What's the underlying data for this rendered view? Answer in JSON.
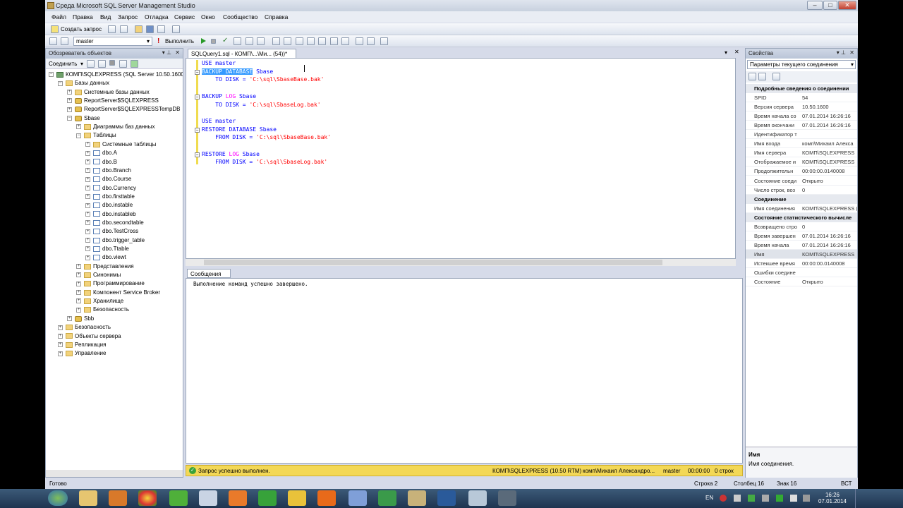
{
  "window": {
    "title": "Среда Microsoft SQL Server Management Studio"
  },
  "menu": [
    "Файл",
    "Правка",
    "Вид",
    "Запрос",
    "Отладка",
    "Сервис",
    "Окно",
    "Сообщество",
    "Справка"
  ],
  "toolbar": {
    "new_query": "Создать запрос",
    "database": "master",
    "execute": "Выполнить"
  },
  "object_explorer": {
    "title": "Обозреватель объектов",
    "connect": "Соединить",
    "tree": [
      {
        "label": "КОМП\\SQLEXPRESS (SQL Server 10.50.1600 -",
        "depth": 0,
        "icon": "server-icon",
        "toggle": "−"
      },
      {
        "label": "Базы данных",
        "depth": 1,
        "icon": "folder-icon",
        "toggle": "−"
      },
      {
        "label": "Системные базы данных",
        "depth": 2,
        "icon": "folder-icon",
        "toggle": "+"
      },
      {
        "label": "ReportServer$SQLEXPRESS",
        "depth": 2,
        "icon": "database-icon",
        "toggle": "+"
      },
      {
        "label": "ReportServer$SQLEXPRESSTempDB",
        "depth": 2,
        "icon": "database-icon",
        "toggle": "+"
      },
      {
        "label": "Sbase",
        "depth": 2,
        "icon": "database-icon",
        "toggle": "−"
      },
      {
        "label": "Диаграммы баз данных",
        "depth": 3,
        "icon": "folder-icon",
        "toggle": "+"
      },
      {
        "label": "Таблицы",
        "depth": 3,
        "icon": "folder-icon",
        "toggle": "−"
      },
      {
        "label": "Системные таблицы",
        "depth": 4,
        "icon": "folder-icon",
        "toggle": "+"
      },
      {
        "label": "dbo.A",
        "depth": 4,
        "icon": "table-icon",
        "toggle": "+"
      },
      {
        "label": "dbo.B",
        "depth": 4,
        "icon": "table-icon",
        "toggle": "+"
      },
      {
        "label": "dbo.Branch",
        "depth": 4,
        "icon": "table-icon",
        "toggle": "+"
      },
      {
        "label": "dbo.Course",
        "depth": 4,
        "icon": "table-icon",
        "toggle": "+"
      },
      {
        "label": "dbo.Currency",
        "depth": 4,
        "icon": "table-icon",
        "toggle": "+"
      },
      {
        "label": "dbo.firsttable",
        "depth": 4,
        "icon": "table-icon",
        "toggle": "+"
      },
      {
        "label": "dbo.instable",
        "depth": 4,
        "icon": "table-icon",
        "toggle": "+"
      },
      {
        "label": "dbo.instableb",
        "depth": 4,
        "icon": "table-icon",
        "toggle": "+"
      },
      {
        "label": "dbo.secondtable",
        "depth": 4,
        "icon": "table-icon",
        "toggle": "+"
      },
      {
        "label": "dbo.TestCross",
        "depth": 4,
        "icon": "table-icon",
        "toggle": "+"
      },
      {
        "label": "dbo.trigger_table",
        "depth": 4,
        "icon": "table-icon",
        "toggle": "+"
      },
      {
        "label": "dbo.Ttable",
        "depth": 4,
        "icon": "table-icon",
        "toggle": "+"
      },
      {
        "label": "dbo.viewt",
        "depth": 4,
        "icon": "table-icon",
        "toggle": "+"
      },
      {
        "label": "Представления",
        "depth": 3,
        "icon": "folder-icon",
        "toggle": "+"
      },
      {
        "label": "Синонимы",
        "depth": 3,
        "icon": "folder-icon",
        "toggle": "+"
      },
      {
        "label": "Программирование",
        "depth": 3,
        "icon": "folder-icon",
        "toggle": "+"
      },
      {
        "label": "Компонент Service Broker",
        "depth": 3,
        "icon": "folder-icon",
        "toggle": "+"
      },
      {
        "label": "Хранилище",
        "depth": 3,
        "icon": "folder-icon",
        "toggle": "+"
      },
      {
        "label": "Безопасность",
        "depth": 3,
        "icon": "folder-icon",
        "toggle": "+"
      },
      {
        "label": "Sbb",
        "depth": 2,
        "icon": "database-icon",
        "toggle": "+"
      },
      {
        "label": "Безопасность",
        "depth": 1,
        "icon": "folder-icon",
        "toggle": "+"
      },
      {
        "label": "Объекты сервера",
        "depth": 1,
        "icon": "folder-icon",
        "toggle": "+"
      },
      {
        "label": "Репликация",
        "depth": 1,
        "icon": "folder-icon",
        "toggle": "+"
      },
      {
        "label": "Управление",
        "depth": 1,
        "icon": "folder-icon",
        "toggle": "+"
      }
    ]
  },
  "editor": {
    "tab": "SQLQuery1.sql - КОМП\\...\\Ми... (54))*",
    "lines": [
      [
        {
          "t": "USE master",
          "c": "kw"
        }
      ],
      [
        {
          "t": "BACKUP DATABASE",
          "c": "kw"
        },
        {
          "t": " Sbase",
          "c": "kw"
        }
      ],
      [
        {
          "t": "    TO DISK = ",
          "c": "kw"
        },
        {
          "t": "'C:\\sql\\SbaseBase.bak'",
          "c": "str"
        }
      ],
      [],
      [
        {
          "t": "BACKUP ",
          "c": "kw"
        },
        {
          "t": "LOG",
          "c": "fn"
        },
        {
          "t": " Sbase",
          "c": "kw"
        }
      ],
      [
        {
          "t": "    TO DISK = ",
          "c": "kw"
        },
        {
          "t": "'C:\\sql\\SbaseLog.bak'",
          "c": "str"
        }
      ],
      [],
      [
        {
          "t": "USE master",
          "c": "kw"
        }
      ],
      [
        {
          "t": "RESTORE DATABASE Sbase",
          "c": "kw"
        }
      ],
      [
        {
          "t": "    FROM DISK = ",
          "c": "kw"
        },
        {
          "t": "'C:\\sql\\SbaseBase.bak'",
          "c": "str"
        }
      ],
      [],
      [
        {
          "t": "RESTORE ",
          "c": "kw"
        },
        {
          "t": "LOG",
          "c": "fn"
        },
        {
          "t": " Sbase",
          "c": "kw"
        }
      ],
      [
        {
          "t": "    FROM DISK = ",
          "c": "kw"
        },
        {
          "t": "'C:\\sql\\SbaseLog.bak'",
          "c": "str"
        }
      ]
    ]
  },
  "messages": {
    "tab": "Сообщения",
    "text": "Выполнение команд успешно завершено."
  },
  "query_status": {
    "text": "Запрос успешно выполнен.",
    "server": "КОМП\\SQLEXPRESS (10.50 RTM)",
    "user": "комп\\Михаил Александро...",
    "db": "master",
    "time": "00:00:00",
    "rows": "0 строк"
  },
  "properties": {
    "title": "Свойства",
    "combo": "Параметры текущего соединения",
    "rows": [
      {
        "cat": "Подробные сведения о соединении"
      },
      {
        "k": "SPID",
        "v": "54"
      },
      {
        "k": "Версия сервера",
        "v": "10.50.1600"
      },
      {
        "k": "Время начала со",
        "v": "07.01.2014 16:26:16"
      },
      {
        "k": "Время окончани",
        "v": "07.01.2014 16:26:16"
      },
      {
        "k": "Идентификатор т",
        "v": ""
      },
      {
        "k": "Имя входа",
        "v": "комп\\Михаил Алекса"
      },
      {
        "k": "Имя сервера",
        "v": "КОМП\\SQLEXPRESS"
      },
      {
        "k": "Отображаемое и",
        "v": "КОМП\\SQLEXPRESS"
      },
      {
        "k": "Продолжительн",
        "v": "00:00:00.0140008"
      },
      {
        "k": "Состояние соеди",
        "v": "Открыто"
      },
      {
        "k": "Число строк, воз",
        "v": "0"
      },
      {
        "cat": "Соединение"
      },
      {
        "k": "Имя соединения",
        "v": "КОМП\\SQLEXPRESS ("
      },
      {
        "cat": "Состояние статистического вычисле"
      },
      {
        "k": "Возвращено стро",
        "v": "0"
      },
      {
        "k": "Время завершен",
        "v": "07.01.2014 16:26:16"
      },
      {
        "k": "Время начала",
        "v": "07.01.2014 16:26:16"
      },
      {
        "k": "Имя",
        "v": "КОМП\\SQLEXPRESS"
      },
      {
        "k": "Истекшее время",
        "v": "00:00:00.0140008"
      },
      {
        "k": "Ошибки соедине",
        "v": ""
      },
      {
        "k": "Состояние",
        "v": "Открыто"
      }
    ],
    "desc_title": "Имя",
    "desc_text": "Имя соединения."
  },
  "statusbar": {
    "ready": "Готово",
    "row": "Строка 2",
    "col": "Столбец 16",
    "ch": "Знак 16",
    "ins": "ВСТ"
  },
  "taskbar": {
    "lang": "EN",
    "time": "16:26",
    "date": "07.01.2014"
  }
}
